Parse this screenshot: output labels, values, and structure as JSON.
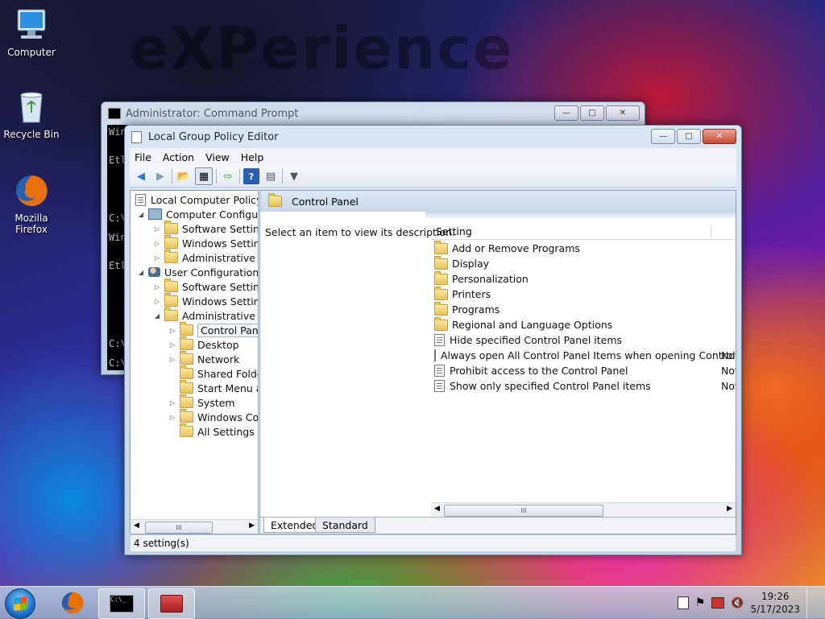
{
  "wallpaper": {
    "text": "eXPerience"
  },
  "desktop": {
    "icons": [
      {
        "label": "Computer"
      },
      {
        "label": "Recycle Bin"
      },
      {
        "label": "Mozilla Firefox"
      }
    ]
  },
  "cmd_window": {
    "title": "Administrator: Command Prompt",
    "lines": [
      "Win",
      "Etl",
      "C:\\",
      "Win",
      "Etl",
      "C:\\",
      "C:\\"
    ]
  },
  "gpe_window": {
    "title": "Local Group Policy Editor",
    "menu": {
      "file": "File",
      "action": "Action",
      "view": "View",
      "help": "Help"
    },
    "tree": {
      "root": "Local Computer Policy",
      "computer_config": "Computer Configura",
      "cc_software": "Software Settings",
      "cc_windows": "Windows Setting",
      "cc_admin": "Administrative Te",
      "user_config": "User Configuration",
      "uc_software": "Software Settings",
      "uc_windows": "Windows Setting",
      "uc_admin": "Administrative Te",
      "control_panel": "Control Panel",
      "desktop": "Desktop",
      "network": "Network",
      "shared_folders": "Shared Folder",
      "start_menu": "Start Menu ar",
      "system": "System",
      "windows_comp": "Windows Cor",
      "all_settings": "All Settings"
    },
    "right": {
      "header": "Control Panel",
      "description": "Select an item to view its description.",
      "column_setting": "Setting",
      "folders": [
        "Add or Remove Programs",
        "Display",
        "Personalization",
        "Printers",
        "Programs",
        "Regional and Language Options"
      ],
      "policies": [
        {
          "name": "Hide specified Control Panel items",
          "state": ""
        },
        {
          "name": "Always open All Control Panel Items when opening Control ...",
          "state": "Not"
        },
        {
          "name": "Prohibit access to the Control Panel",
          "state": "Not"
        },
        {
          "name": "Show only specified Control Panel items",
          "state": "Not"
        }
      ],
      "tabs": {
        "extended": "Extended",
        "standard": "Standard"
      }
    },
    "status": "4 setting(s)"
  },
  "taskbar": {
    "clock_time": "19:26",
    "clock_date": "5/17/2023"
  }
}
